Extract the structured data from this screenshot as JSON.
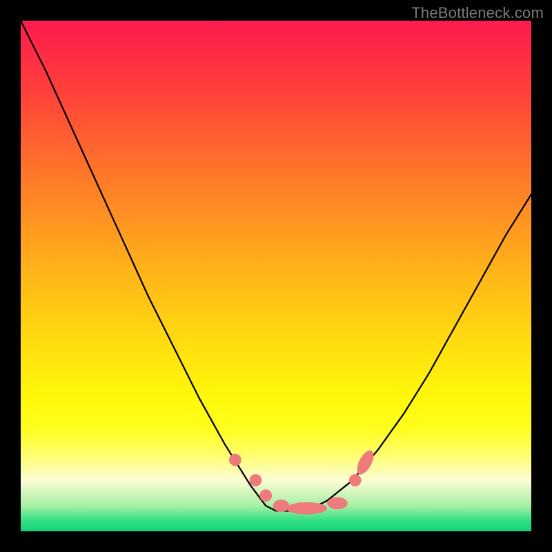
{
  "watermark": "TheBottleneck.com",
  "chart_data": {
    "type": "line",
    "title": "",
    "xlabel": "",
    "ylabel": "",
    "xlim": [
      0,
      1
    ],
    "ylim": [
      0,
      1
    ],
    "grid": false,
    "series": [
      {
        "name": "v-curve",
        "x": [
          0.0,
          0.05,
          0.1,
          0.15,
          0.2,
          0.25,
          0.3,
          0.35,
          0.4,
          0.45,
          0.48,
          0.5,
          0.52,
          0.55,
          0.58,
          0.6,
          0.65,
          0.7,
          0.75,
          0.8,
          0.85,
          0.9,
          0.95,
          1.0
        ],
        "y": [
          1.0,
          0.9,
          0.79,
          0.68,
          0.57,
          0.46,
          0.36,
          0.26,
          0.17,
          0.09,
          0.05,
          0.04,
          0.04,
          0.04,
          0.05,
          0.06,
          0.1,
          0.16,
          0.23,
          0.31,
          0.4,
          0.49,
          0.58,
          0.66
        ]
      }
    ],
    "markers": [
      {
        "name": "left-dot-1",
        "x": 0.42,
        "y": 0.14,
        "r": 0.012
      },
      {
        "name": "left-dot-2",
        "x": 0.46,
        "y": 0.1,
        "r": 0.012
      },
      {
        "name": "left-dot-3",
        "x": 0.48,
        "y": 0.07,
        "r": 0.012
      },
      {
        "name": "flat-left",
        "x": 0.51,
        "y": 0.05,
        "rx": 0.016,
        "ry": 0.012,
        "pill": true
      },
      {
        "name": "flat-center",
        "x": 0.56,
        "y": 0.045,
        "rx": 0.04,
        "ry": 0.012,
        "pill": true
      },
      {
        "name": "flat-right",
        "x": 0.62,
        "y": 0.055,
        "rx": 0.02,
        "ry": 0.012,
        "pill": true
      },
      {
        "name": "right-dot-1",
        "x": 0.655,
        "y": 0.1,
        "r": 0.012
      },
      {
        "name": "right-pill-1",
        "x": 0.675,
        "y": 0.135,
        "rx": 0.012,
        "ry": 0.026,
        "pill": true,
        "rotate": 28
      }
    ],
    "colors": {
      "curve": "#000000",
      "marker_fill": "#ee7b7b",
      "gradient_top": "#ff1a50",
      "gradient_bottom": "#18d07a"
    }
  }
}
